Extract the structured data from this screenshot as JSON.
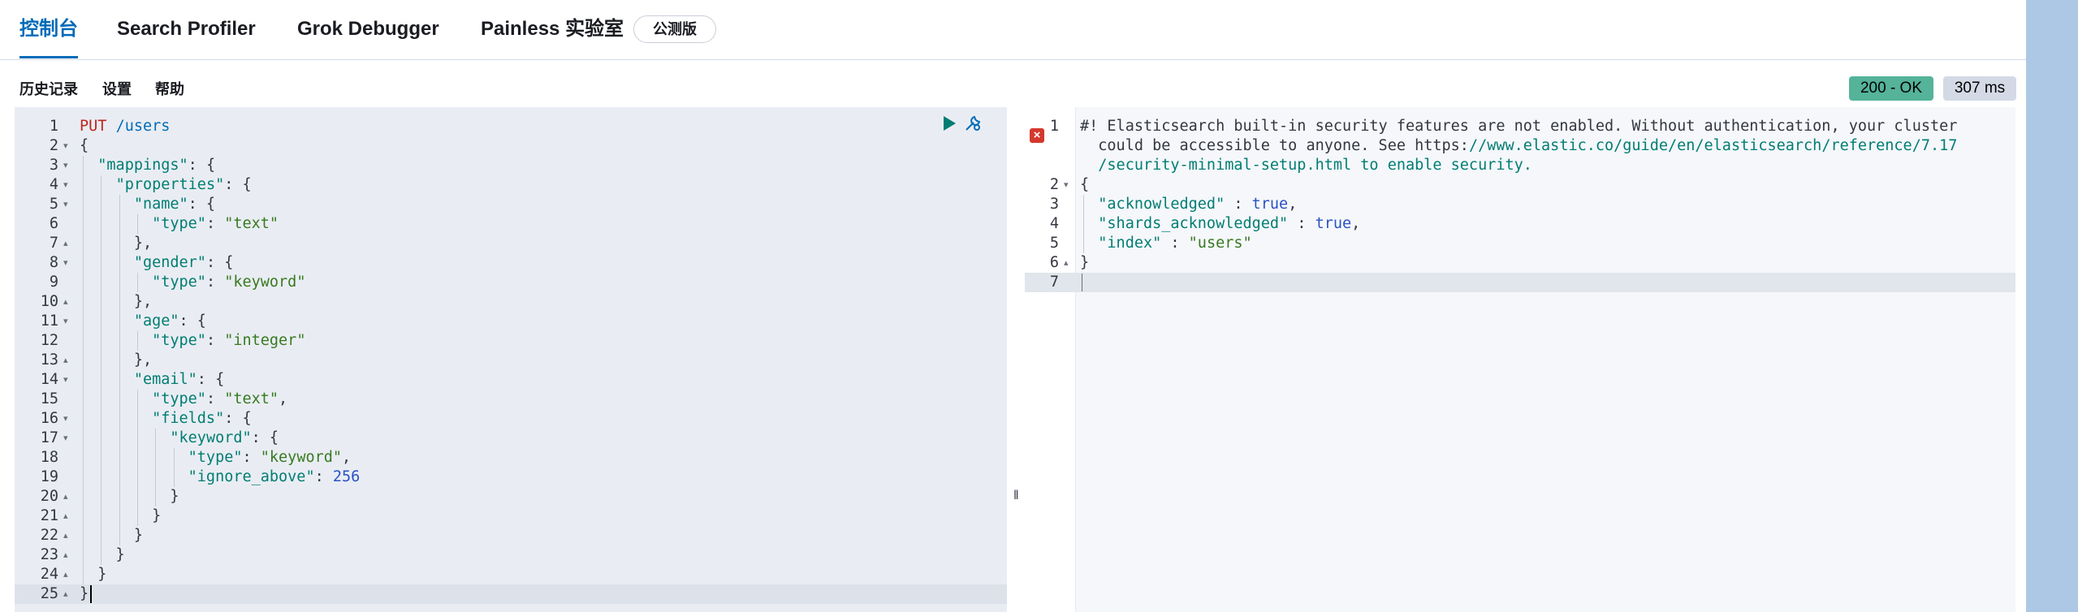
{
  "tabs": [
    {
      "label": "控制台",
      "active": true
    },
    {
      "label": "Search Profiler",
      "active": false
    },
    {
      "label": "Grok Debugger",
      "active": false
    },
    {
      "label": "Painless 实验室",
      "active": false
    }
  ],
  "beta_badge": "公测版",
  "menu": {
    "history": "历史记录",
    "settings": "设置",
    "help": "帮助"
  },
  "status": {
    "code": "200 - OK",
    "time": "307 ms",
    "ok_color": "#54b399"
  },
  "icons": {
    "run": "play-icon",
    "options": "wrench-icon",
    "error": "error-cross-icon",
    "resize": "drag-handle-icon"
  },
  "request": {
    "method": "PUT",
    "path": "/users",
    "line_count": 25,
    "lines": [
      "{",
      "  \"mappings\": {",
      "    \"properties\": {",
      "      \"name\": {",
      "        \"type\": \"text\"",
      "      },",
      "      \"gender\": {",
      "        \"type\": \"keyword\"",
      "      },",
      "      \"age\": {",
      "        \"type\": \"integer\"",
      "      },",
      "      \"email\": {",
      "        \"type\": \"text\",",
      "        \"fields\": {",
      "          \"keyword\": {",
      "            \"type\": \"keyword\",",
      "            \"ignore_above\": 256",
      "          }",
      "        }",
      "      }",
      "    }",
      "  }",
      "}"
    ]
  },
  "response": {
    "warning_line1": "#! Elasticsearch built-in security features are not enabled. Without authentication, your cluster",
    "warning_line2a": "  could be accessible to anyone. See https:",
    "warning_line2b": "//www.elastic.co/guide/en/elasticsearch/reference/7.17",
    "warning_line3": "  /security-minimal-setup.html to enable security.",
    "body": [
      "{",
      "  \"acknowledged\" : true,",
      "  \"shards_acknowledged\" : true,",
      "  \"index\" : \"users\"",
      "}",
      ""
    ]
  }
}
